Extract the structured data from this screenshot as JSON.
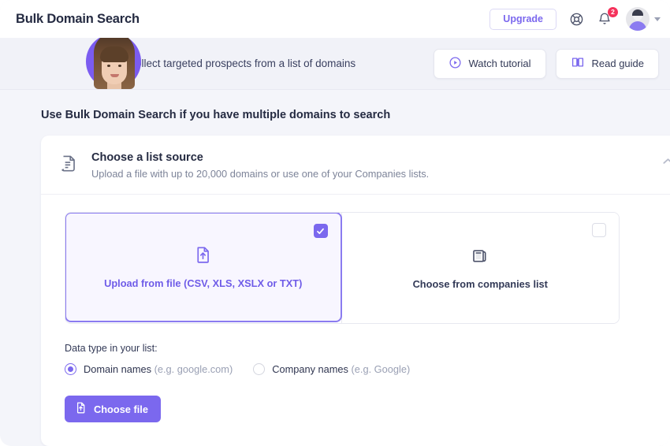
{
  "header": {
    "title": "Bulk Domain Search",
    "upgrade_label": "Upgrade",
    "help_icon": "lifebuoy-icon",
    "notifications_icon": "bell-icon",
    "notification_count": "2",
    "avatar_icon": "user-avatar",
    "user_menu_icon": "chevron-down-icon"
  },
  "banner": {
    "avatar_icon": "instructor-photo",
    "text": "Learn to collect targeted prospects from a list of domains",
    "watch_tutorial": {
      "label": "Watch tutorial",
      "icon": "play-circle-icon"
    },
    "read_guide": {
      "label": "Read guide",
      "icon": "book-icon"
    }
  },
  "main": {
    "section_title": "Use Bulk Domain Search if you have multiple domains to search",
    "card": {
      "icon": "document-list-icon",
      "title": "Choose a list source",
      "subtitle": "Upload a file with up to 20,000 domains or use one of your Companies lists.",
      "collapse_icon": "chevron-up-icon",
      "choices": [
        {
          "label": "Upload from file (CSV, XLS, XSLX or TXT)",
          "icon": "file-upload-icon",
          "selected": true,
          "checkbox_icon": "checkmark-icon"
        },
        {
          "label": "Choose from companies list",
          "icon": "companies-list-icon",
          "selected": false,
          "checkbox_icon": "empty-checkbox-icon"
        }
      ],
      "data_type_label": "Data type in your list:",
      "radios": [
        {
          "label": "Domain names",
          "hint": "(e.g. google.com)",
          "selected": true
        },
        {
          "label": "Company names",
          "hint": "(e.g. Google)",
          "selected": false
        }
      ],
      "choose_file": {
        "label": "Choose file",
        "icon": "file-upload-icon"
      }
    }
  },
  "colors": {
    "accent": "#7b68ee",
    "accent_light": "#8b7bf0",
    "badge": "#f5325b",
    "title": "#252b42",
    "page_bg": "#f4f5fa",
    "banner_bg": "#f1f2f8"
  }
}
